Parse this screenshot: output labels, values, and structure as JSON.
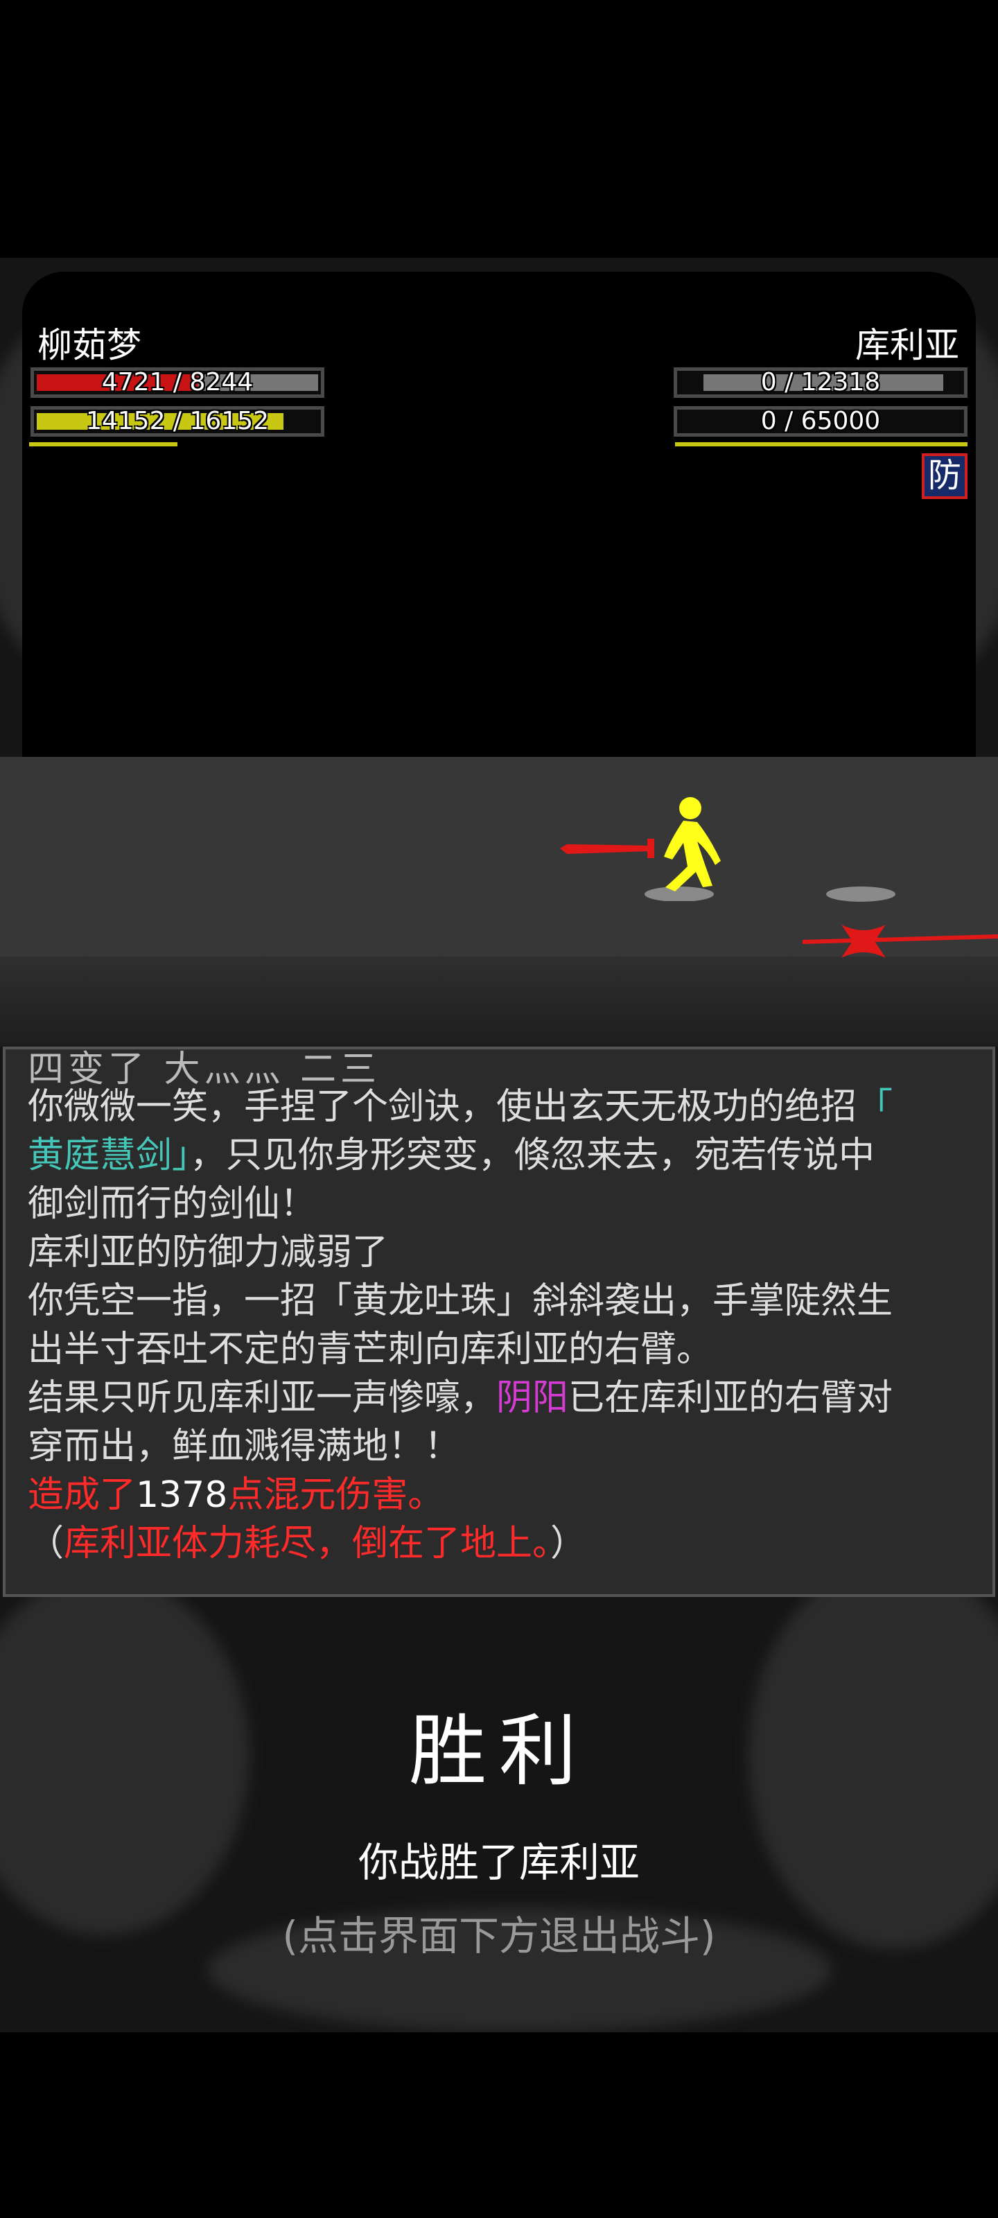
{
  "player": {
    "name": "柳茹梦",
    "hp": {
      "current": 4721,
      "max": 8244,
      "text": "4721 / 8244",
      "color": "#c81414"
    },
    "mp": {
      "current": 14152,
      "max": 16152,
      "text": "14152 / 16152",
      "color": "#c8c814"
    }
  },
  "enemy": {
    "name": "库利亚",
    "hp": {
      "current": 0,
      "max": 12318,
      "text": "0 / 12318"
    },
    "mp": {
      "current": 0,
      "max": 65000,
      "text": "0 / 65000"
    },
    "status_icon": "防"
  },
  "log": {
    "cut_line": "四变了 大灬灬 二三",
    "line1": {
      "a": "你微微一笑，手捏了个剑诀，使出玄天无极功的绝招",
      "b": "「"
    },
    "line2": {
      "a": "黄庭慧剑」",
      "b": "，只见你身形突变，倏忽来去，宛若传说中"
    },
    "line3": "御剑而行的剑仙！",
    "line4": "库利亚的防御力减弱了",
    "line5": "你凭空一指，一招「黄龙吐珠」斜斜袭出，手掌陡然生",
    "line6": "出半寸吞吐不定的青芒刺向库利亚的右臂。",
    "line7": {
      "a": "结果只听见库利亚一声惨嚎，",
      "b": "阴阳",
      "c": "已在库利亚的右臂对"
    },
    "line8": "穿而出，鲜血溅得满地！！",
    "line9": {
      "a": "造成了",
      "b": "1378",
      "c": "点混元伤害。"
    },
    "line10": {
      "a": "（",
      "b": "库利亚体力耗尽，倒在了地上。",
      "c": "）"
    }
  },
  "result": {
    "title": "胜利",
    "description": "你战胜了库利亚",
    "hint": "(点击界面下方退出战斗)"
  }
}
